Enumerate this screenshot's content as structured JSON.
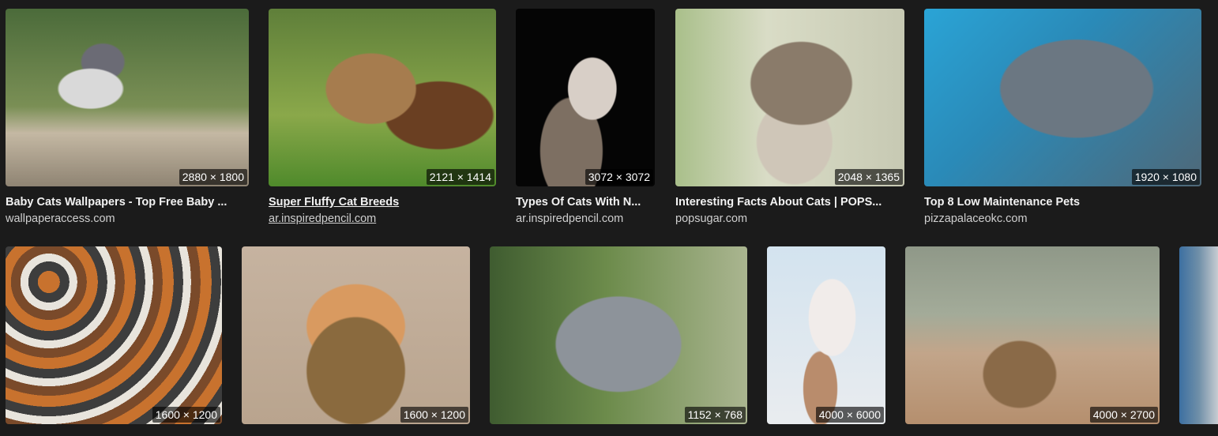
{
  "results": [
    {
      "title": "Baby Cats Wallpapers - Top Free Baby ...",
      "source": "wallpaperaccess.com",
      "dimensions": "2880 × 1800",
      "underlined": false
    },
    {
      "title": "Super Fluffy Cat Breeds",
      "source": "ar.inspiredpencil.com",
      "dimensions": "2121 × 1414",
      "underlined": true
    },
    {
      "title": "Types Of Cats With N...",
      "source": "ar.inspiredpencil.com",
      "dimensions": "3072 × 3072",
      "underlined": false
    },
    {
      "title": "Interesting Facts About Cats | POPS...",
      "source": "popsugar.com",
      "dimensions": "2048 × 1365",
      "underlined": false
    },
    {
      "title": "Top 8 Low Maintenance Pets",
      "source": "pizzapalaceokc.com",
      "dimensions": "1920 × 1080",
      "underlined": false
    },
    {
      "dimensions": "1600 × 1200"
    },
    {
      "dimensions": "1600 × 1200"
    },
    {
      "dimensions": "1152 × 768"
    },
    {
      "dimensions": "4000 × 6000"
    },
    {
      "dimensions": "4000 × 2700"
    },
    {}
  ],
  "icons": [
    "photo-thumbnail"
  ],
  "colors": {
    "background": "#1b1b1b",
    "title": "#f2f2f2",
    "source": "#cfcfcf"
  }
}
